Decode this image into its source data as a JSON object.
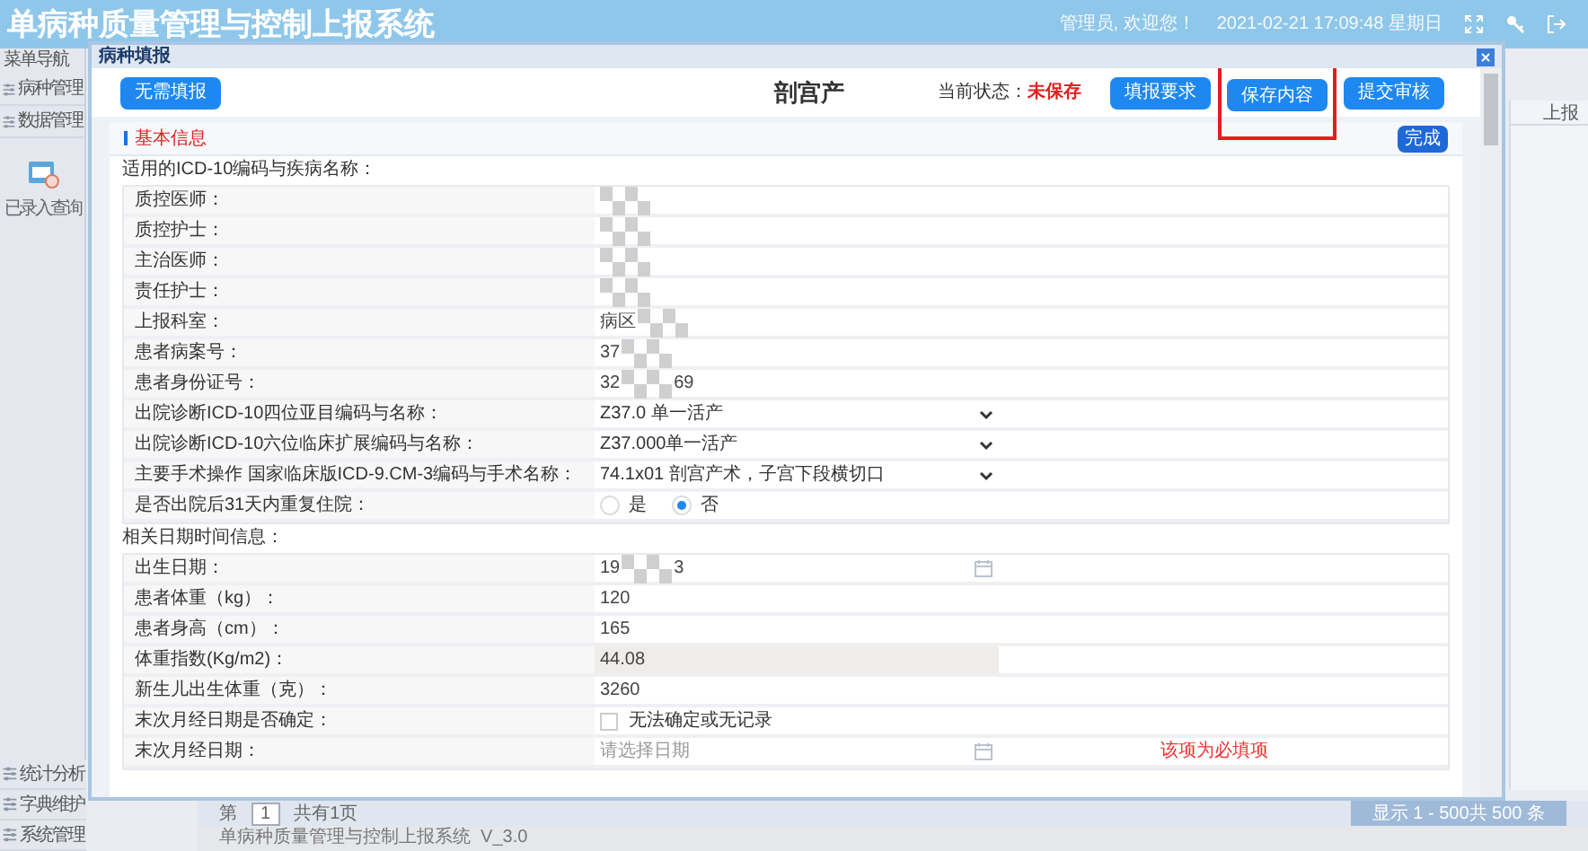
{
  "app": {
    "title": "单病种质量管理与控制上报系统",
    "user": "管理员, 欢迎您！",
    "datetime": "2021-02-21 17:09:48 星期日"
  },
  "sidebar": {
    "heading": "菜单导航",
    "items": [
      {
        "label": "病种管理"
      },
      {
        "label": "数据管理"
      }
    ],
    "shortcut": "已录入查询",
    "bottom_items": [
      {
        "label": "统计分析"
      },
      {
        "label": "字典维护"
      },
      {
        "label": "系统管理"
      }
    ]
  },
  "background_table": {
    "column": "上报"
  },
  "pagination": {
    "page_label": "第",
    "page": "1",
    "total": "共有1页",
    "summary": "显示 1 - 500共 500 条"
  },
  "status_bar": "单病种质量管理与控制上报系统  V_3.0",
  "dialog": {
    "title": "病种填报",
    "heading": "剖宫产",
    "skip_button": "无需填报",
    "status_label": "当前状态：",
    "status": "未保存",
    "buttons": [
      {
        "label": "填报要求",
        "highlighted": false
      },
      {
        "label": "保存内容",
        "highlighted": true
      },
      {
        "label": "提交审核",
        "highlighted": false
      }
    ],
    "panel": {
      "title": "基本信息",
      "done_button": "完成",
      "sections": [
        {
          "title": "适用的ICD-10编码与疾病名称：",
          "rows": [
            {
              "label": "质控医师：",
              "kind": "text",
              "masked": true
            },
            {
              "label": "质控护士：",
              "kind": "text",
              "masked": true
            },
            {
              "label": "主治医师：",
              "kind": "text",
              "masked": true
            },
            {
              "label": "责任护士：",
              "kind": "text",
              "masked": true
            },
            {
              "label": "上报科室：",
              "kind": "text",
              "value": "病区",
              "masked": true
            },
            {
              "label": "患者病案号：",
              "kind": "text",
              "value": "37",
              "masked": true
            },
            {
              "label": "患者身份证号：",
              "kind": "text",
              "value": "32",
              "suffix": "69",
              "masked": true
            },
            {
              "label": "出院诊断ICD-10四位亚目编码与名称：",
              "kind": "select",
              "value": "Z37.0 单一活产"
            },
            {
              "label": "出院诊断ICD-10六位临床扩展编码与名称：",
              "kind": "select",
              "value": "Z37.000单一活产"
            },
            {
              "label": "主要手术操作 国家临床版ICD-9.CM-3编码与手术名称：",
              "kind": "select",
              "value": "74.1x01 剖宫产术，子宫下段横切口"
            },
            {
              "label": "是否出院后31天内重复住院：",
              "kind": "radio",
              "options": [
                {
                  "label": "是",
                  "selected": false
                },
                {
                  "label": "否",
                  "selected": true
                }
              ]
            }
          ]
        },
        {
          "title": "相关日期时间信息：",
          "rows": [
            {
              "label": "出生日期：",
              "kind": "date",
              "value": "19",
              "suffix": "3",
              "masked": true
            },
            {
              "label": "患者体重（kg）：",
              "kind": "text",
              "value": "120"
            },
            {
              "label": "患者身高（cm）：",
              "kind": "text",
              "value": "165"
            },
            {
              "label": "体重指数(Kg/m2)：",
              "kind": "readonly",
              "value": "44.08"
            },
            {
              "label": "新生儿出生体重（克）：",
              "kind": "text",
              "value": "3260"
            },
            {
              "label": "末次月经日期是否确定：",
              "kind": "checkbox",
              "option": {
                "label": "无法确定或无记录",
                "checked": false
              }
            },
            {
              "label": "末次月经日期：",
              "kind": "date",
              "placeholder": "请选择日期",
              "note": "该项为必填项"
            }
          ]
        }
      ]
    }
  }
}
